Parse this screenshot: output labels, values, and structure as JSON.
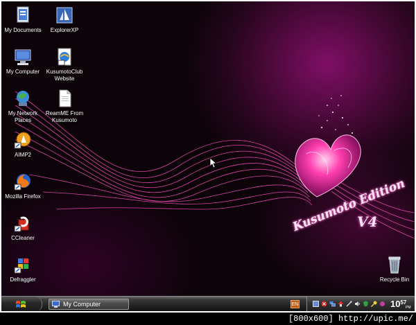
{
  "desktop": {
    "icons": [
      {
        "name": "my-documents-icon",
        "label": "My Documents"
      },
      {
        "name": "explorerxp-icon",
        "label": "ExplorerXP"
      },
      {
        "name": "my-computer-icon",
        "label": "My Computer"
      },
      {
        "name": "kusumotoclub-website-icon",
        "label": "KusumotoClub\nWebsite"
      },
      {
        "name": "my-network-places-icon",
        "label": "My Network\nPlaces"
      },
      {
        "name": "readme-icon",
        "label": "ReamME From\nKusumoto"
      },
      {
        "name": "aimp2-icon",
        "label": "AIMP2"
      },
      {
        "name": "mozilla-firefox-icon",
        "label": "Mozilla Firefox"
      },
      {
        "name": "ccleaner-icon",
        "label": "CCleaner"
      },
      {
        "name": "defraggler-icon",
        "label": "Defraggler"
      },
      {
        "name": "recycle-bin-icon",
        "label": "Recycle Bin"
      }
    ],
    "wallpaper_text": "Kusumoto Edition",
    "wallpaper_version": "V4"
  },
  "taskbar": {
    "task_button_label": "My Computer",
    "language": "EN",
    "clock_hour": "10",
    "clock_minute": "57",
    "clock_ampm": "PM"
  },
  "footer": {
    "text": "[800x600] http://upic.me/"
  },
  "colors": {
    "accent": "#ff2fa8",
    "wallpaper_dark": "#0c0409",
    "taskbar": "#222222"
  }
}
